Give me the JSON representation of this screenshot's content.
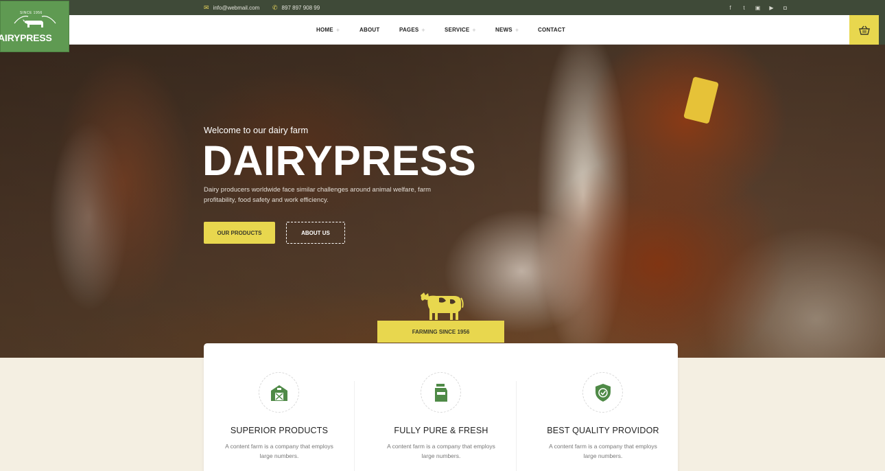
{
  "topbar": {
    "email": "info@webmail.com",
    "phone": "897 897 908 99",
    "social_icons": [
      "facebook-icon",
      "twitter-icon",
      "linkedin-icon",
      "youtube-icon",
      "instagram-icon"
    ],
    "background": "#3f4a38"
  },
  "logo": {
    "name": "AIRYPRESS",
    "since": "SINCE 1956"
  },
  "nav": {
    "items": [
      {
        "label": "HOME",
        "has_submenu": true
      },
      {
        "label": "ABOUT",
        "has_submenu": false
      },
      {
        "label": "PAGES",
        "has_submenu": true
      },
      {
        "label": "SERVICE",
        "has_submenu": true
      },
      {
        "label": "NEWS",
        "has_submenu": true
      },
      {
        "label": "CONTACT",
        "has_submenu": false
      }
    ],
    "plus": "+",
    "cart_icon": "basket-icon"
  },
  "hero": {
    "welcome": "Welcome to our dairy farm",
    "title": "DAIRYPRESS",
    "lede": "Dairy producers worldwide face similar challenges around animal welfare, farm profitability, food safety and work efficiency.",
    "primary_button": "OUR PRODUCTS",
    "secondary_button": "ABOUT US",
    "badge": "FARMING SINCE 1956"
  },
  "features": [
    {
      "icon": "barn-icon",
      "title": "SUPERIOR PRODUCTS",
      "text": "A content farm is a company that employs large numbers."
    },
    {
      "icon": "milk-carton-icon",
      "title": "FULLY PURE & FRESH",
      "text": "A content farm is a company that employs large numbers."
    },
    {
      "icon": "shield-check-icon",
      "title": "BEST QUALITY PROVIDOR",
      "text": "A content farm is a company that employs large numbers."
    }
  ],
  "colors": {
    "accent_yellow": "#e8d74e",
    "brand_green": "#5f9a52",
    "dark_green": "#3f4a38",
    "cream": "#f4efe2"
  }
}
